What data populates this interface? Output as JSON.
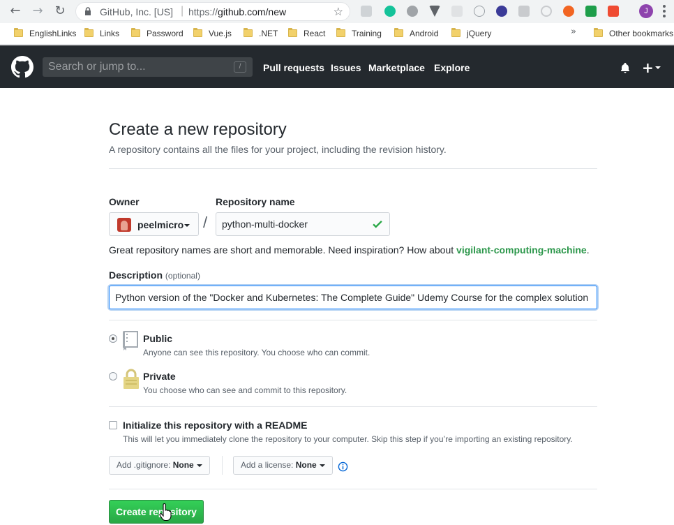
{
  "browser": {
    "site_label": "GitHub, Inc. [US]",
    "url_prefix": "https://",
    "url_host": "github.com/new",
    "profile_initial": "J",
    "bookmarks": [
      "EnglishLinks",
      "Links",
      "Password",
      "Vue.js",
      ".NET",
      "React",
      "Training",
      "Android",
      "jQuery"
    ],
    "other_bookmarks": "Other bookmarks",
    "more_glyph": "»"
  },
  "header": {
    "search_placeholder": "Search or jump to...",
    "search_shortcut": "/",
    "nav": [
      "Pull requests",
      "Issues",
      "Marketplace",
      "Explore"
    ],
    "plus_glyph": "+"
  },
  "form": {
    "title": "Create a new repository",
    "subtitle": "A repository contains all the files for your project, including the revision history.",
    "owner_label": "Owner",
    "owner_value": "peelmicro",
    "separator": "/",
    "repo_name_label": "Repository name",
    "repo_name_value": "python-multi-docker",
    "hint_text": "Great repository names are short and memorable. Need inspiration? How about ",
    "hint_suggestion": "vigilant-computing-machine",
    "hint_end": ".",
    "description_label": "Description",
    "description_optional": "(optional)",
    "description_value": "Python version of the \"Docker and Kubernetes: The Complete Guide\" Udemy Course for the complex solution",
    "visibility": {
      "selected": "public",
      "public_title": "Public",
      "public_note": "Anyone can see this repository. You choose who can commit.",
      "private_title": "Private",
      "private_note": "You choose who can see and commit to this repository."
    },
    "readme_checked": false,
    "readme_title": "Initialize this repository with a README",
    "readme_note": "This will let you immediately clone the repository to your computer. Skip this step if you’re importing an existing repository.",
    "gitignore_label": "Add .gitignore:",
    "gitignore_value": "None",
    "license_label": "Add a license:",
    "license_value": "None",
    "submit_label": "Create repository"
  },
  "colors": {
    "header_bg": "#24292e",
    "primary_button": "#28a745",
    "focus_border": "#2188ff"
  }
}
